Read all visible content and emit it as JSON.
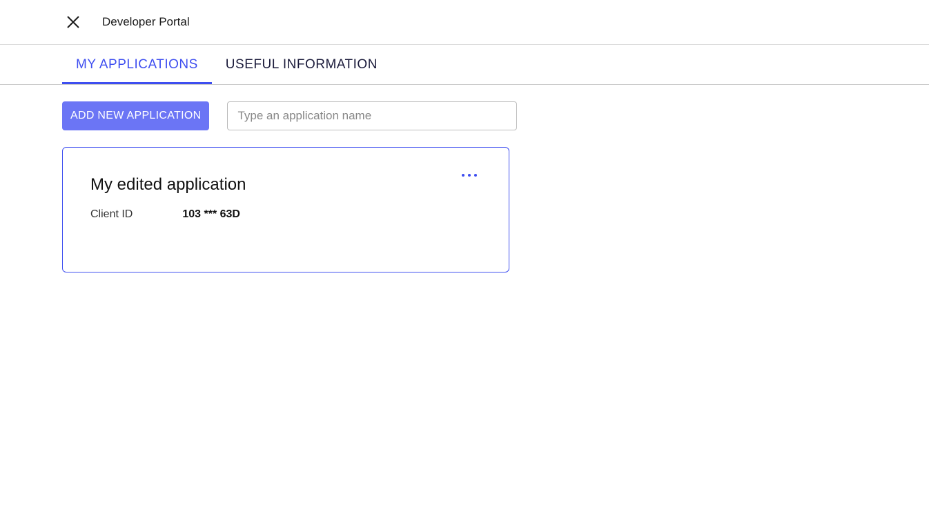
{
  "header": {
    "title": "Developer Portal"
  },
  "tabs": [
    {
      "label": "MY APPLICATIONS",
      "active": true
    },
    {
      "label": "USEFUL INFORMATION",
      "active": false
    }
  ],
  "toolbar": {
    "add_button_label": "ADD NEW APPLICATION",
    "search_placeholder": "Type an application name",
    "search_value": ""
  },
  "applications": [
    {
      "name": "My edited application",
      "client_id_label": "Client ID",
      "client_id_value": "103 *** 63D"
    }
  ]
}
